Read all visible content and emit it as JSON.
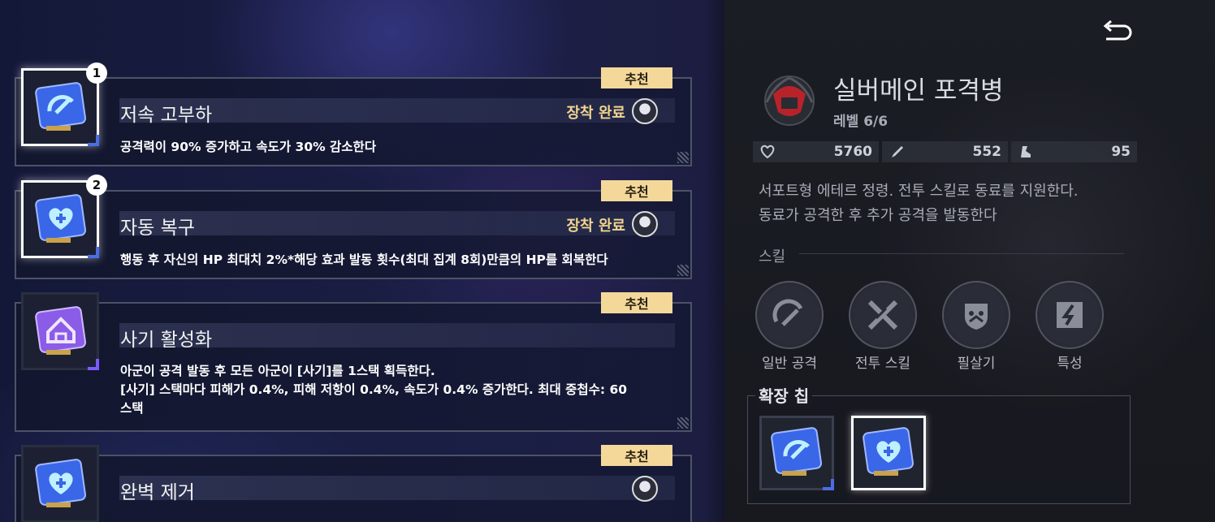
{
  "chips": [
    {
      "number": "1",
      "badge": "추천",
      "title": "저속 고부하",
      "equipped_label": "장착 완료",
      "description": "공격력이 90% 증가하고 속도가 30% 감소한다",
      "icon": "gauge-icon",
      "color": "blue"
    },
    {
      "number": "2",
      "badge": "추천",
      "title": "자동 복구",
      "equipped_label": "장착 완료",
      "description": "행동 후 자신의 HP 최대치 2%*해당 효과 발동 횟수(최대 집계 8회)만큼의 HP를 회복한다",
      "icon": "heart-shield-icon",
      "color": "blue"
    },
    {
      "badge": "추천",
      "title": "사기 활성화",
      "description_lines": [
        "아군이 공격 발동 후 모든 아군이 [사기]를 1스택 획득한다.",
        "[사기] 스택마다 피해가 0.4%, 피해 저항이 0.4%, 속도가 0.4% 증가한다. 최대 중첩수: 60",
        "스택"
      ],
      "icon": "house-icon",
      "color": "purple"
    },
    {
      "badge": "추천",
      "title": "완벽 제거",
      "icon": "heart-shield-icon",
      "color": "blue"
    }
  ],
  "character": {
    "name": "실버메인 포격병",
    "level": "레벨 6/6",
    "stats": {
      "hp": "5760",
      "attack": "552",
      "speed": "95"
    },
    "description_lines": [
      "서포트형 에테르 정령. 전투 스킬로 동료를 지원한다.",
      "동료가 공격한 후 추가 공격을 발동한다"
    ]
  },
  "skills_section": "스킬",
  "skills": [
    {
      "label": "일반 공격",
      "icon": "gauge-icon"
    },
    {
      "label": "전투 스킬",
      "icon": "crossed-swords-icon"
    },
    {
      "label": "필살기",
      "icon": "skull-shield-icon"
    },
    {
      "label": "특성",
      "icon": "lightning-icon"
    }
  ],
  "extension": {
    "label": "확장 칩"
  },
  "colors": {
    "badge": "#f3d89a",
    "equipped": "#f0d48f",
    "accent_blue": "#4b6de6",
    "accent_purple": "#7c5cff"
  }
}
